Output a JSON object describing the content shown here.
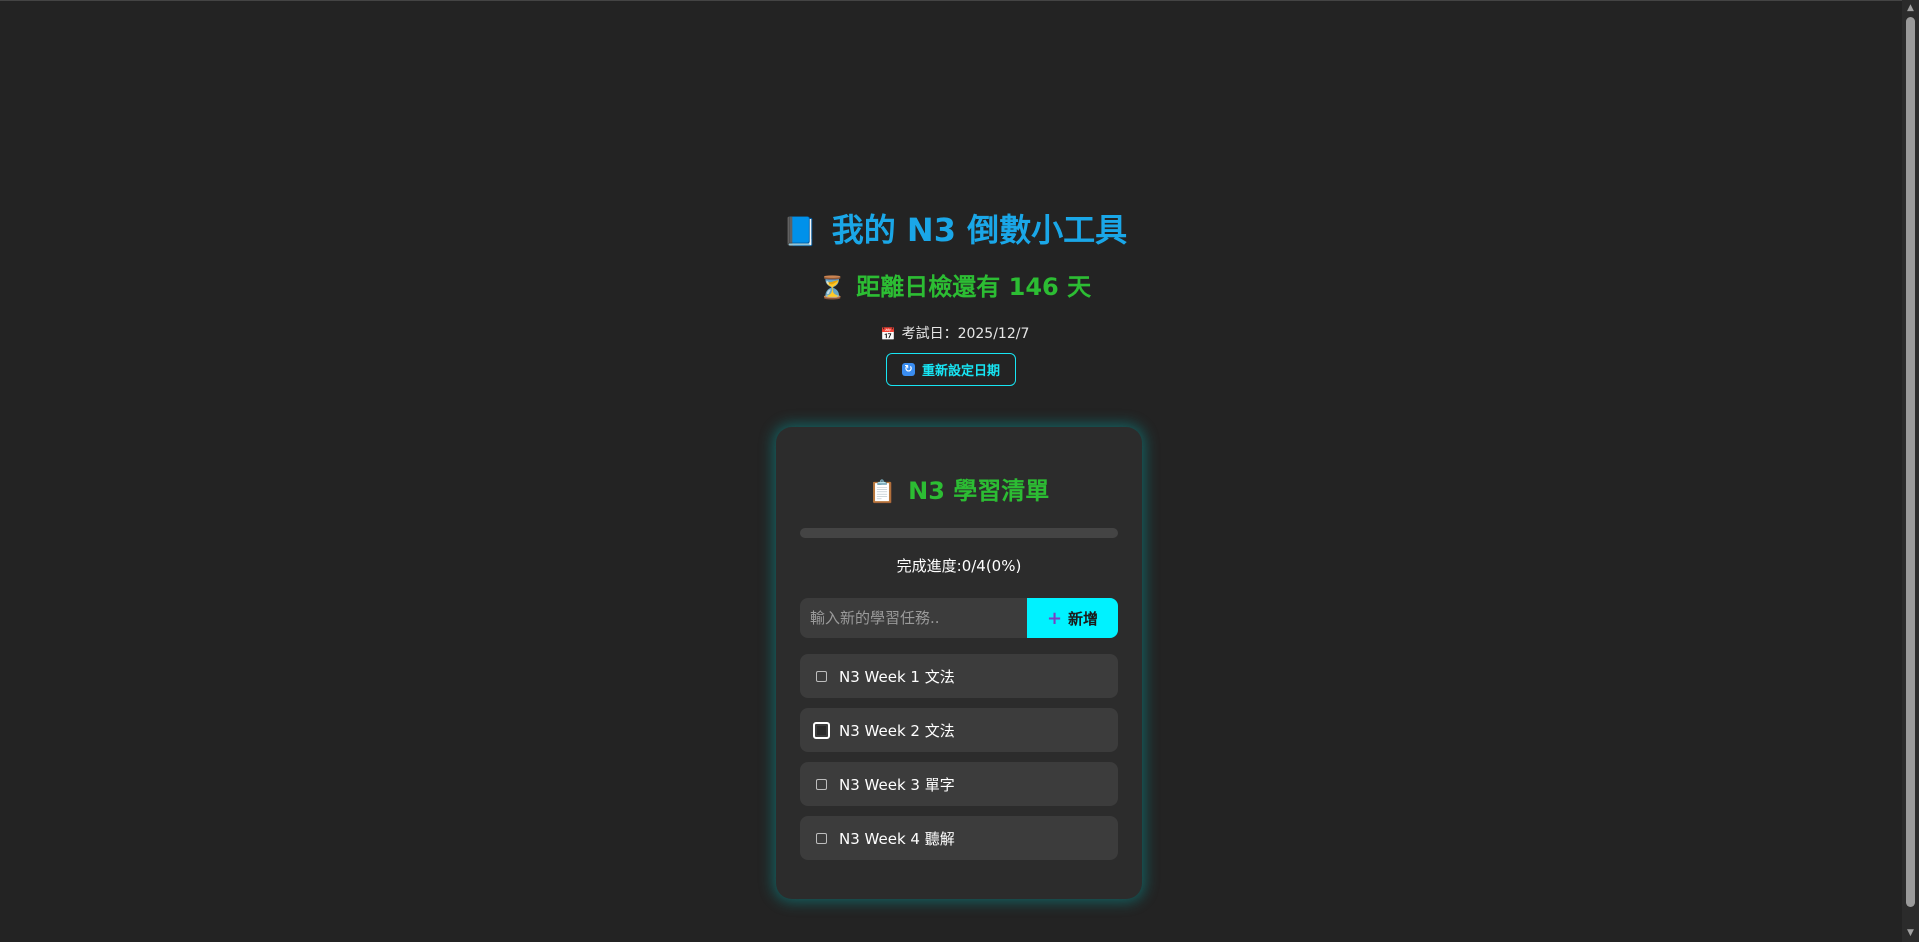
{
  "header": {
    "title_icon": "blue-book-icon",
    "title": "我的 N3 倒數小工具",
    "countdown_icon": "hourglass-icon",
    "countdown": "距離日檢還有 146 天",
    "exam_date_icon": "calendar-icon",
    "exam_date": "考試日：2025/12/7",
    "reset_icon": "refresh-icon",
    "reset_label": "重新設定日期"
  },
  "checklist": {
    "title_icon": "clipboard-icon",
    "title": "N3 學習清單",
    "progress_fraction": 0,
    "progress_text": "完成進度:0/4(0%)",
    "input_placeholder": "輸入新的學習任務..",
    "add_icon": "plus-icon",
    "add_label": "新增",
    "tasks": [
      {
        "label": "N3 Week 1 文法",
        "checked": false
      },
      {
        "label": "N3 Week 2 文法",
        "checked": false
      },
      {
        "label": "N3 Week 3 單字",
        "checked": false
      },
      {
        "label": "N3 Week 4 聽解",
        "checked": false
      }
    ]
  },
  "colors": {
    "background": "#232323",
    "title": "#1aa7e8",
    "accent_green": "#2cbd33",
    "accent_cyan": "#00f2ff",
    "card": "#2c2c2c"
  }
}
